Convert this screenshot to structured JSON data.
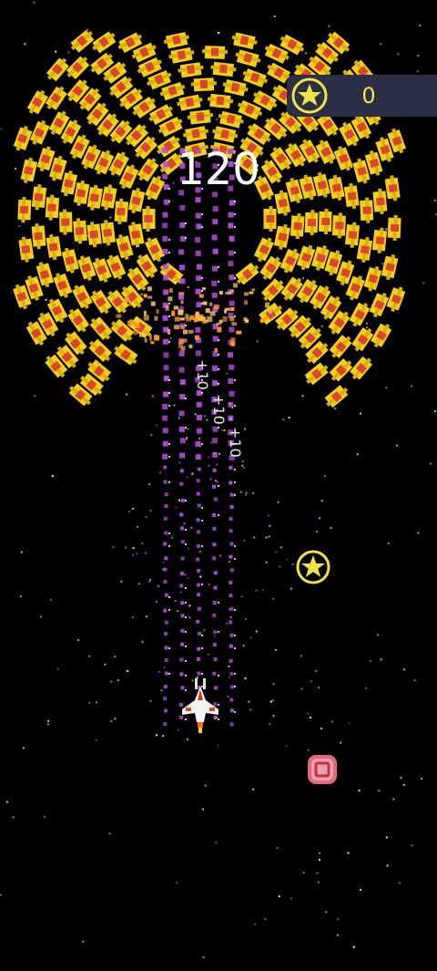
{
  "hud": {
    "score": "120",
    "coins": "0",
    "coin_icon": "star-coin-icon",
    "coin_color": "#f0e24a",
    "panel_color": "#2b2f45"
  },
  "floating_points": [
    "+10",
    "+10",
    "+10"
  ],
  "pickups": [
    {
      "name": "bonus-star",
      "icon": "star-coin-icon",
      "color": "#f0e24a"
    },
    {
      "name": "powerup",
      "icon": "target-powerup-icon",
      "color": "#e06a7e"
    }
  ],
  "colors": {
    "enemy_body": "#f2cf1a",
    "enemy_core": "#d8462b",
    "bullet": "#b04bd8",
    "spark": "#ff9a2a",
    "background": "#000000"
  }
}
